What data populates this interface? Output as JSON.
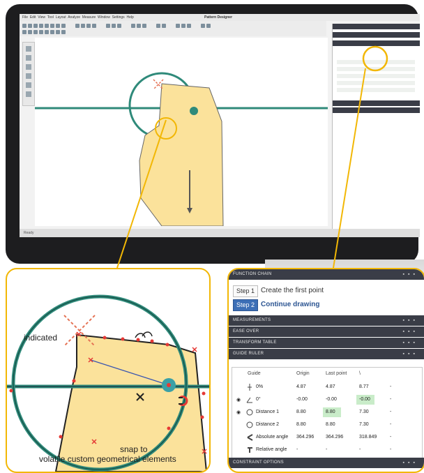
{
  "screen": {
    "title": "Pattern Designer",
    "menu": [
      "File",
      "Edit",
      "View",
      "Tool",
      "Layout",
      "Analyze",
      "Measure",
      "Window",
      "Settings",
      "Help"
    ],
    "status": "Ready"
  },
  "callout_left": {
    "label_indicated": "indicated",
    "label_snap": "snap to",
    "label_volatile": "volatile custom geometrical elements"
  },
  "dock": {
    "section_function_chain": "FUNCTION CHAIN",
    "steps": [
      {
        "button": "Step 1",
        "text": "Create the first point",
        "active": false
      },
      {
        "button": "Step 2",
        "text": "Continue drawing",
        "active": true
      }
    ],
    "section_measurements": "MEASUREMENTS",
    "section_ease_over": "EASE OVER",
    "section_transform_table": "TRANSFORM TABLE",
    "section_guide_rules": "GUIDE RULER",
    "section_constraint_options": "CONSTRAINT OPTIONS",
    "table": {
      "headers": [
        "Guide",
        "Origin",
        "Last point",
        "\\"
      ],
      "rows": [
        {
          "name": "0%",
          "origin": "4.87",
          "last": "4.87",
          "delta": "8.77",
          "extra": "-"
        },
        {
          "name": "0°",
          "origin": "-0.00",
          "last": "-0.00",
          "delta": "-0.00",
          "extra": "-"
        },
        {
          "name": "Distance 1",
          "origin": "8.80",
          "last": "8.80",
          "delta": "7.30",
          "extra": "-"
        },
        {
          "name": "Distance 2",
          "origin": "8.80",
          "last": "8.80",
          "delta": "7.30",
          "extra": "-"
        },
        {
          "name": "Absolute angle",
          "origin": "364.296",
          "last": "364.296",
          "delta": "318.849",
          "extra": "-"
        },
        {
          "name": "Relative angle",
          "origin": "-",
          "last": "-",
          "delta": "-",
          "extra": "-"
        }
      ]
    }
  },
  "colors": {
    "accent_yellow": "#f2b705",
    "pattern_fill": "#fbe29b",
    "guide_green": "#2f8a7a",
    "marker_red": "#e53935",
    "dock_header": "#3a3d47",
    "step_active": "#3d6fb6"
  }
}
